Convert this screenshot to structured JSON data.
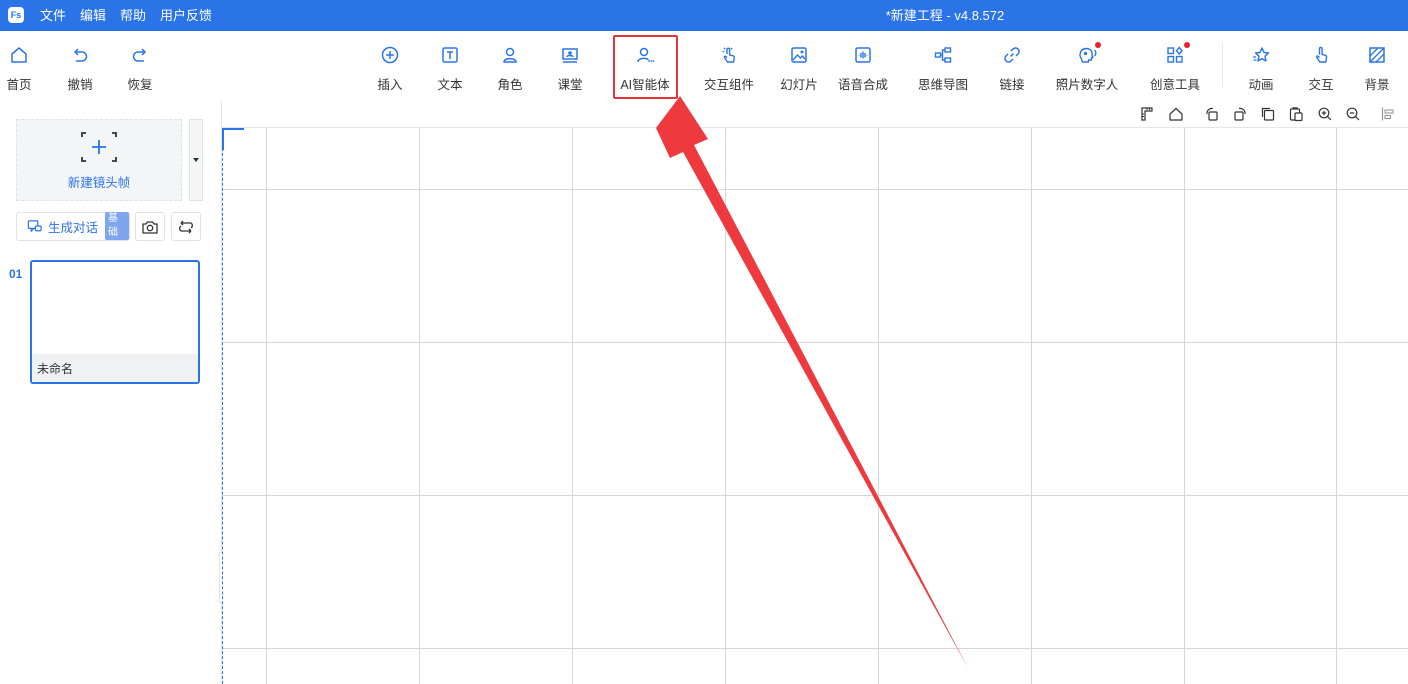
{
  "titlebar": {
    "logo": "Fs",
    "menu": [
      "文件",
      "编辑",
      "帮助",
      "用户反馈"
    ],
    "title": "*新建工程 - v4.8.572"
  },
  "toolbar": {
    "home": "首页",
    "undo": "撤销",
    "redo": "恢复",
    "insert": "插入",
    "text": "文本",
    "role": "角色",
    "classroom": "课堂",
    "ai_agent": "AI智能体",
    "interactive_component": "交互组件",
    "slides": "幻灯片",
    "speech_synthesis": "语音合成",
    "mind_map": "思维导图",
    "link": "链接",
    "photo_digital_human": "照片数字人",
    "creative_tools": "创意工具",
    "animation": "动画",
    "interaction": "交互",
    "background": "背景"
  },
  "sidebar": {
    "new_frame_label": "新建镜头帧",
    "generate_dialog_label": "生成对话",
    "generate_dialog_badge": "基础",
    "frames": [
      {
        "number": "01",
        "caption": "未命名"
      }
    ]
  },
  "colors": {
    "brand_blue": "#2b74e8",
    "highlight_red": "#e8323a",
    "new_dot_red": "#e8202a"
  },
  "icons": {
    "toolbar": [
      "home-icon",
      "undo-icon",
      "redo-icon",
      "insert-plus-icon",
      "text-icon",
      "role-icon",
      "classroom-icon",
      "ai-agent-icon",
      "interactive-component-icon",
      "slides-icon",
      "speech-synthesis-icon",
      "mind-map-icon",
      "link-icon",
      "photo-digital-human-icon",
      "creative-tools-icon",
      "animation-icon",
      "interaction-icon",
      "background-icon"
    ],
    "canvas_tools": [
      "ruler-icon",
      "home-icon",
      "rotate-left-icon",
      "rotate-right-icon",
      "copy-icon",
      "paste-icon",
      "zoom-in-icon",
      "zoom-out-icon",
      "align-left-icon"
    ]
  }
}
